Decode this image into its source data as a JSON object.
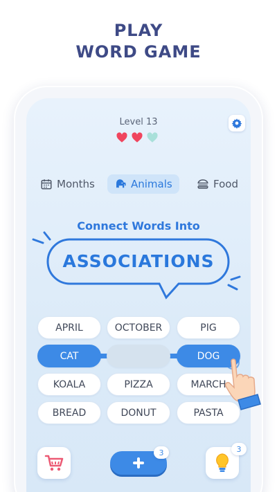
{
  "promo": {
    "line1": "PLAY",
    "line2": "WORD GAME"
  },
  "header": {
    "level": "Level 13",
    "hearts": {
      "filled": 2,
      "total": 3
    }
  },
  "categories": [
    {
      "label": "Months",
      "icon": "calendar-icon",
      "active": false
    },
    {
      "label": "Animals",
      "icon": "elephant-icon",
      "active": true
    },
    {
      "label": "Food",
      "icon": "burger-icon",
      "active": false
    }
  ],
  "puzzle": {
    "subtitle": "Connect Words Into",
    "title": "ASSOCIATIONS"
  },
  "words": [
    [
      "APRIL",
      "OCTOBER",
      "PIG"
    ],
    [
      "CAT",
      "",
      "DOG"
    ],
    [
      "KOALA",
      "PIZZA",
      "MARCH"
    ],
    [
      "BREAD",
      "DONUT",
      "PASTA"
    ]
  ],
  "selected": [
    "CAT",
    "DOG"
  ],
  "toolbar": {
    "shop_icon": "cart-icon",
    "add_count": "3",
    "hint_icon": "lightbulb-icon",
    "hint_count": "3"
  },
  "colors": {
    "accent": "#3d8ae6",
    "heart_filled": "#f0455e",
    "heart_empty": "#a9e0da",
    "headline": "#3e4a86"
  }
}
